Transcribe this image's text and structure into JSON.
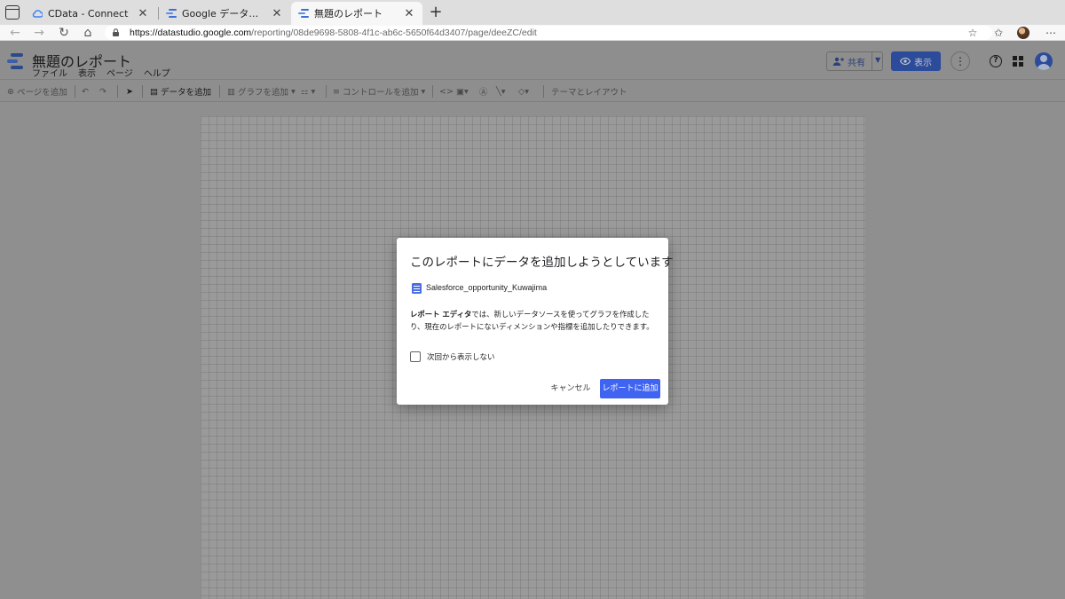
{
  "browser": {
    "tabs": [
      {
        "label": "CData - Connect",
        "icon": "cloud-icon"
      },
      {
        "label": "Google データポータル",
        "icon": "data-studio-icon"
      },
      {
        "label": "無題のレポート",
        "icon": "data-studio-icon",
        "active": true
      }
    ],
    "url_host": "https://datastudio.google.com",
    "url_path": "/reporting/08de9698-5808-4f1c-ab6c-5650f64d3407/page/deeZC/edit"
  },
  "app": {
    "title": "無題のレポート",
    "menus": [
      "ファイル",
      "表示",
      "ページ",
      "ヘルプ"
    ],
    "share_label": "共有",
    "view_label": "表示"
  },
  "toolbar": {
    "add_page": "ページを追加",
    "add_data": "データを追加",
    "add_chart": "グラフを追加",
    "add_control": "コントロールを追加",
    "theme_layout": "テーマとレイアウト"
  },
  "dialog": {
    "title": "このレポートにデータを追加しようとしています",
    "datasource": "Salesforce_opportunity_Kuwajima",
    "body_bold": "レポート エディタ",
    "body_rest": "では、新しいデータソースを使ってグラフを作成したり、現在のレポートにないディメンションや指標を追加したりできます。",
    "checkbox_label": "次回から表示しない",
    "checkbox_checked": false,
    "cancel_label": "キャンセル",
    "confirm_label": "レポートに追加"
  },
  "colors": {
    "primary_button": "#4064f2",
    "datasource_icon": "#4a6fe3",
    "overlay": "#8f8f8f"
  }
}
